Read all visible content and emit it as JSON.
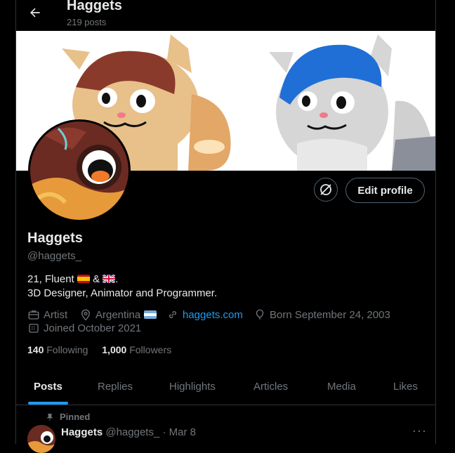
{
  "header": {
    "title": "Haggets",
    "subtitle": "219 posts"
  },
  "profile": {
    "edit_label": "Edit profile",
    "name": "Haggets",
    "handle": "@haggets_",
    "bio_line1_prefix": "21, Fluent",
    "bio_line1_mid": "&",
    "bio_line1_suffix": ".",
    "bio_line2": "3D Designer, Animator and Programmer.",
    "job": "Artist",
    "location": "Argentina",
    "website": "haggets.com",
    "born": "Born September 24, 2003",
    "joined": "Joined October 2021",
    "following_count": "140",
    "following_label": "Following",
    "followers_count": "1,000",
    "followers_label": "Followers"
  },
  "tabs": [
    "Posts",
    "Replies",
    "Highlights",
    "Articles",
    "Media",
    "Likes"
  ],
  "post": {
    "pinned_label": "Pinned",
    "author": "Haggets",
    "handle": "@haggets_",
    "separator": "·",
    "date": "Mar 8",
    "more": "···"
  },
  "colors": {
    "accent": "#1d9bf0",
    "border": "#2f3336",
    "muted": "#71767b",
    "text": "#e7e9ea"
  }
}
